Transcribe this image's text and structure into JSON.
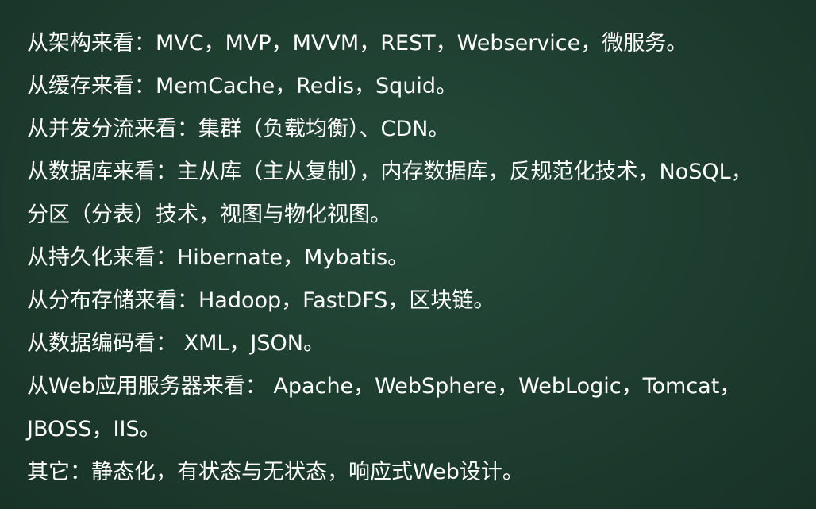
{
  "slide": {
    "lines": [
      "从架构来看：MVC，MVP，MVVM，REST，Webservice，微服务。",
      "从缓存来看：MemCache，Redis，Squid。",
      "从并发分流来看：集群（负载均衡）、CDN。",
      "从数据库来看：主从库（主从复制），内存数据库，反规范化技术，NoSQL，",
      "分区（分表）技术，视图与物化视图。",
      "从持久化来看：Hibernate，Mybatis。",
      "从分布存储来看：Hadoop，FastDFS，区块链。",
      "从数据编码看： XML，JSON。",
      "从Web应用服务器来看： Apache，WebSphere，WebLogic，Tomcat，",
      "JBOSS，IIS。",
      "其它：静态化，有状态与无状态，响应式Web设计。"
    ]
  }
}
